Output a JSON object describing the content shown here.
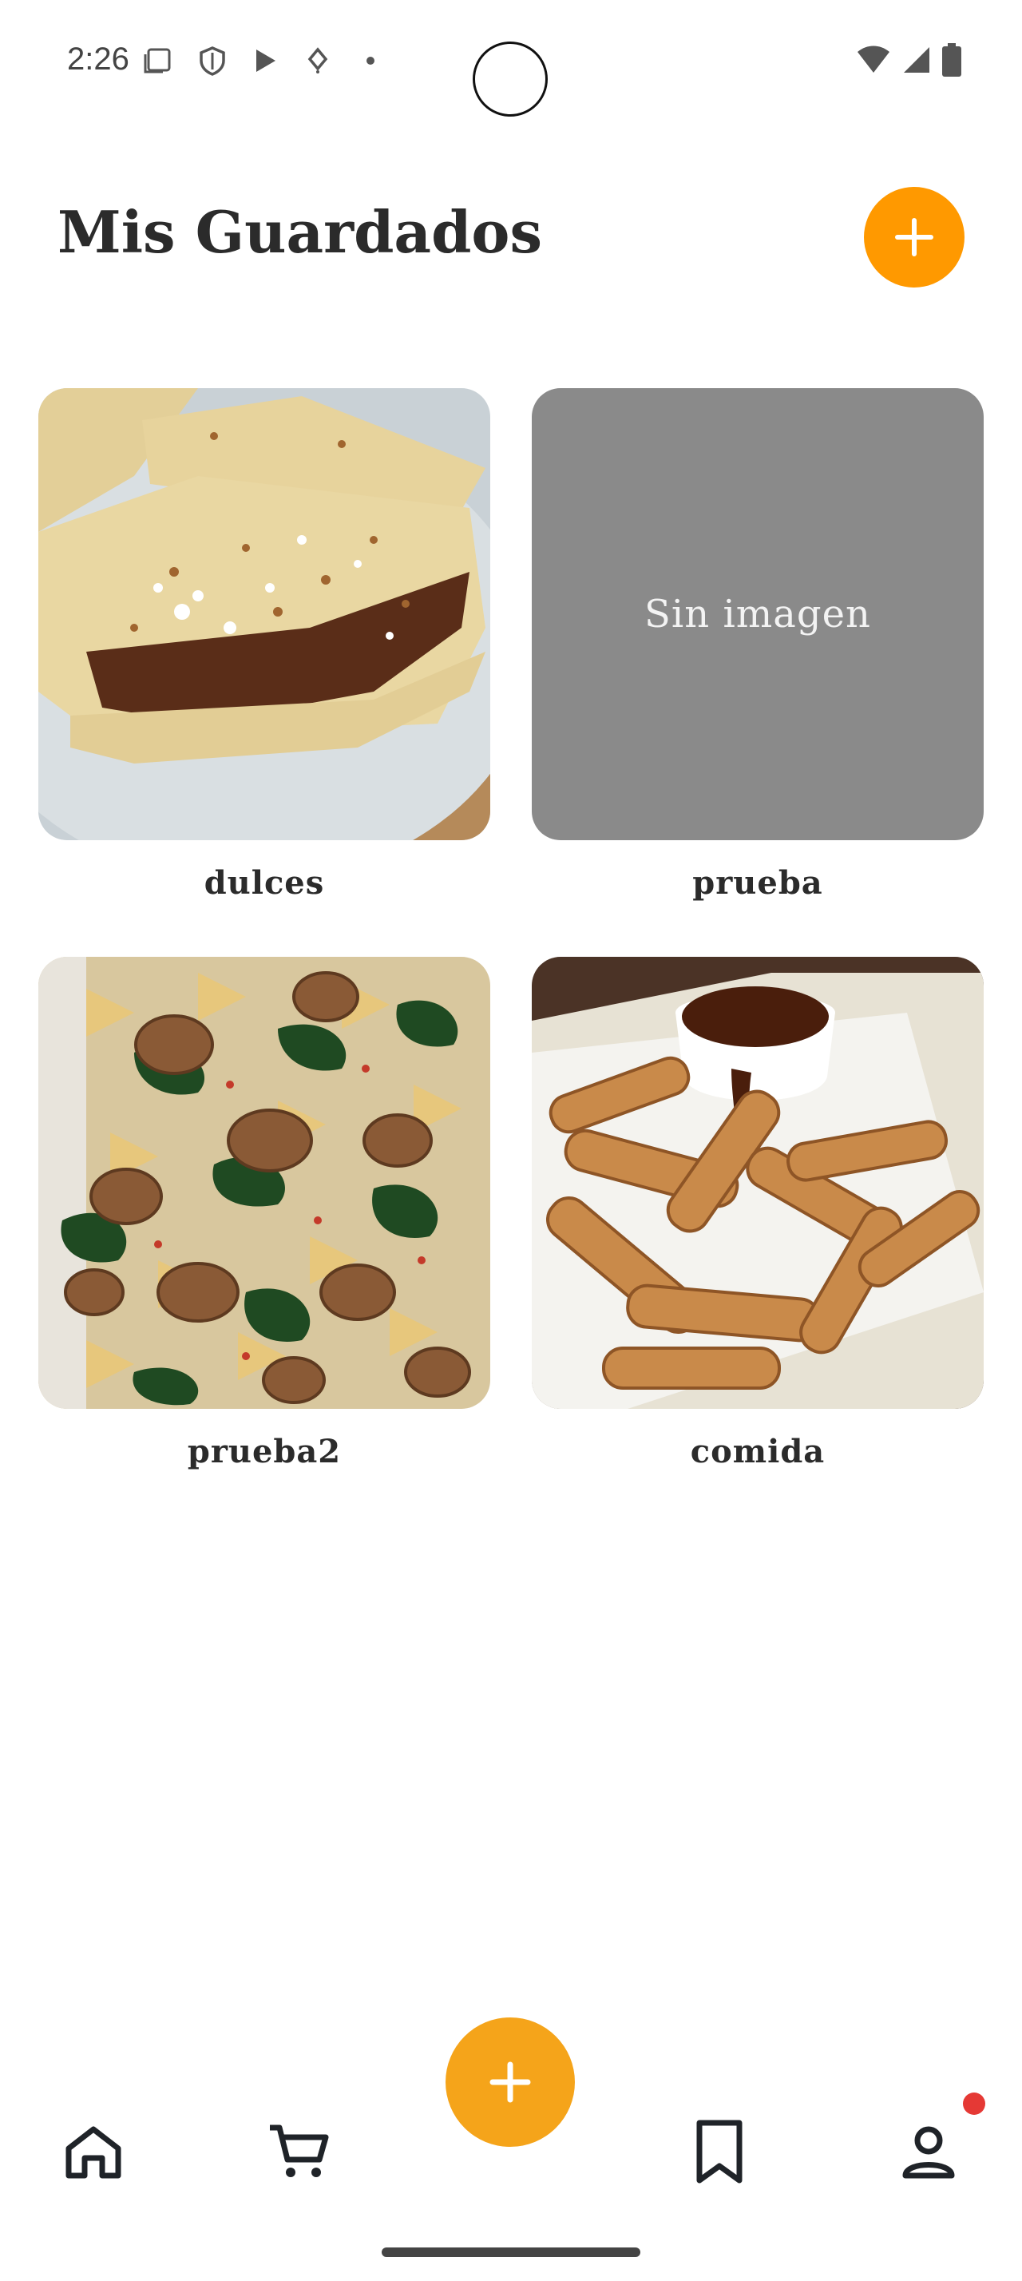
{
  "status_bar": {
    "time": "2:26"
  },
  "header": {
    "title": "Mis Guardados",
    "add_icon": "plus-icon"
  },
  "collections": [
    {
      "label": "dulces",
      "image": "crepes-photo"
    },
    {
      "label": "prueba",
      "image": null,
      "placeholder": "Sin imagen"
    },
    {
      "label": "prueba2",
      "image": "pasta-photo"
    },
    {
      "label": "comida",
      "image": "churros-photo"
    }
  ],
  "bottom_nav": {
    "items": [
      "home-icon",
      "cart-icon",
      "add-fab",
      "bookmark-icon",
      "profile-icon"
    ],
    "active": "bookmark-icon",
    "notification": true
  },
  "colors": {
    "accent": "#ff9900",
    "fab": "#f5a41a",
    "placeholder": "#8a8a8a",
    "notification": "#e53935"
  }
}
